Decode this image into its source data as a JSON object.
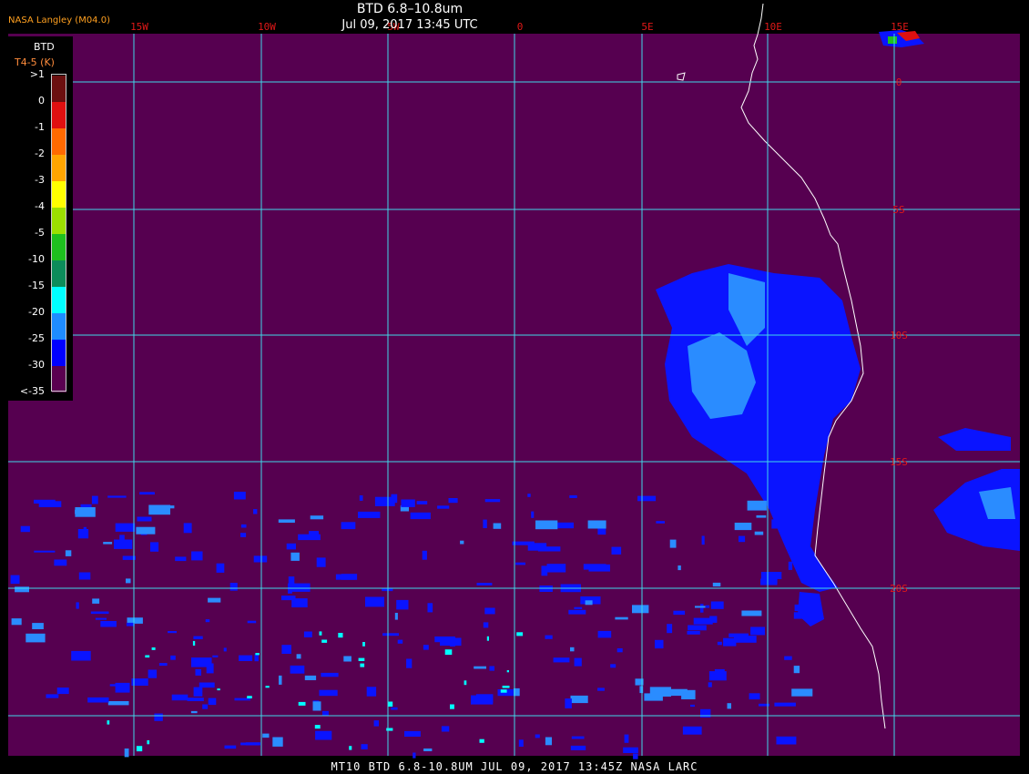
{
  "header": {
    "title": "BTD 6.8–10.8um",
    "date": "Jul 09, 2017 13:45 UTC",
    "org": "NASA Langley (M04.0)"
  },
  "footer": "MT10  BTD 6.8-10.8UM   JUL 09, 2017 13:45Z   NASA LARC",
  "legend": {
    "title": "BTD",
    "subtitle": "T4-5 (K)",
    "levels": [
      ">1",
      "0",
      "-1",
      "-2",
      "-3",
      "-4",
      "-5",
      "-10",
      "-15",
      "-20",
      "-25",
      "-30",
      "<-35"
    ],
    "colors": [
      "#6b0f0f",
      "#e01010",
      "#ff6a00",
      "#ffa500",
      "#ffff00",
      "#9be000",
      "#1ec01e",
      "#0c8c5a",
      "#00ffff",
      "#1e8cff",
      "#0000ff",
      "#5a0050"
    ]
  },
  "map": {
    "background": "#560050",
    "grid_color": "#40d8e8",
    "label_color": "#e01818",
    "lon_labels": [
      "15W",
      "10W",
      "5W",
      "0",
      "5E",
      "10E",
      "15E"
    ],
    "lat_labels": [
      "0",
      "5S",
      "10S",
      "15S",
      "20S"
    ]
  }
}
